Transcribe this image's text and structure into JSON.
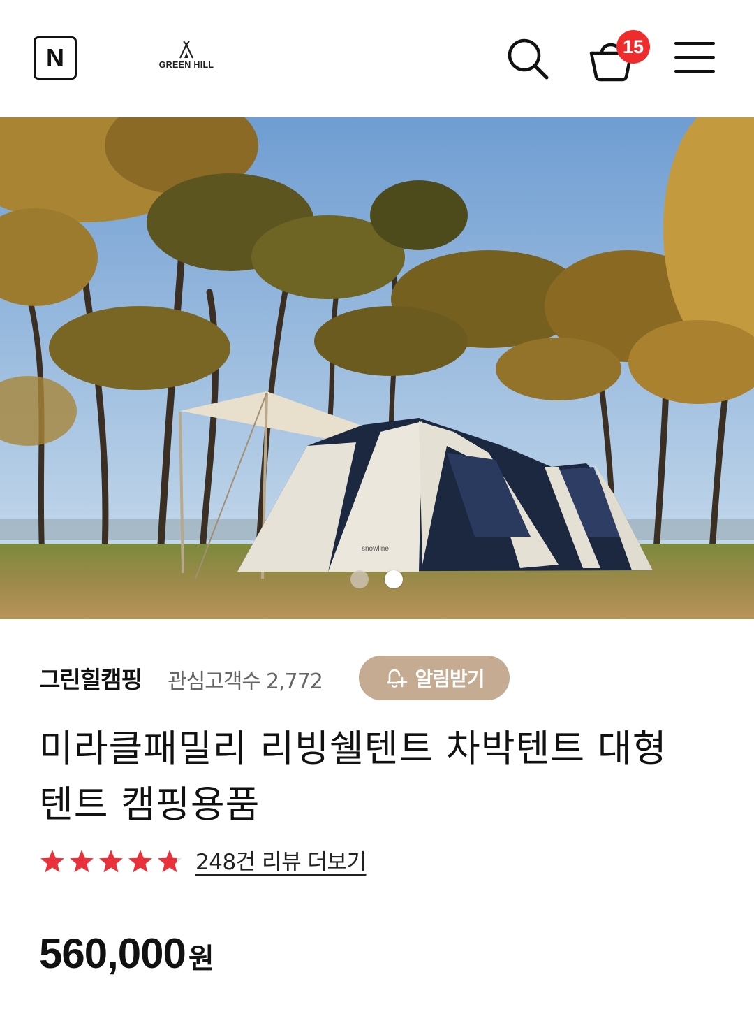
{
  "header": {
    "n_label": "N",
    "logo_text": "GREEN HILL",
    "cart_count": "15"
  },
  "hero": {
    "tent_brand": "snowline",
    "slide_count": 2,
    "active_slide": 2
  },
  "store": {
    "name": "그린힐캠핑",
    "followers_label": "관심고객수",
    "followers_count": "2,772",
    "notify_label": "알림받기"
  },
  "product": {
    "title_line1": "미라클패밀리 리빙쉘텐트 차박텐트 대형",
    "title_line2": "텐트 캠핑용품",
    "rating": 4.8,
    "review_link": "248건 리뷰 더보기",
    "price": "560,000",
    "currency": "원"
  },
  "colors": {
    "accent_badge": "#ef2b2b",
    "notify_button": "#c4ab92",
    "star": "#e8313a"
  }
}
